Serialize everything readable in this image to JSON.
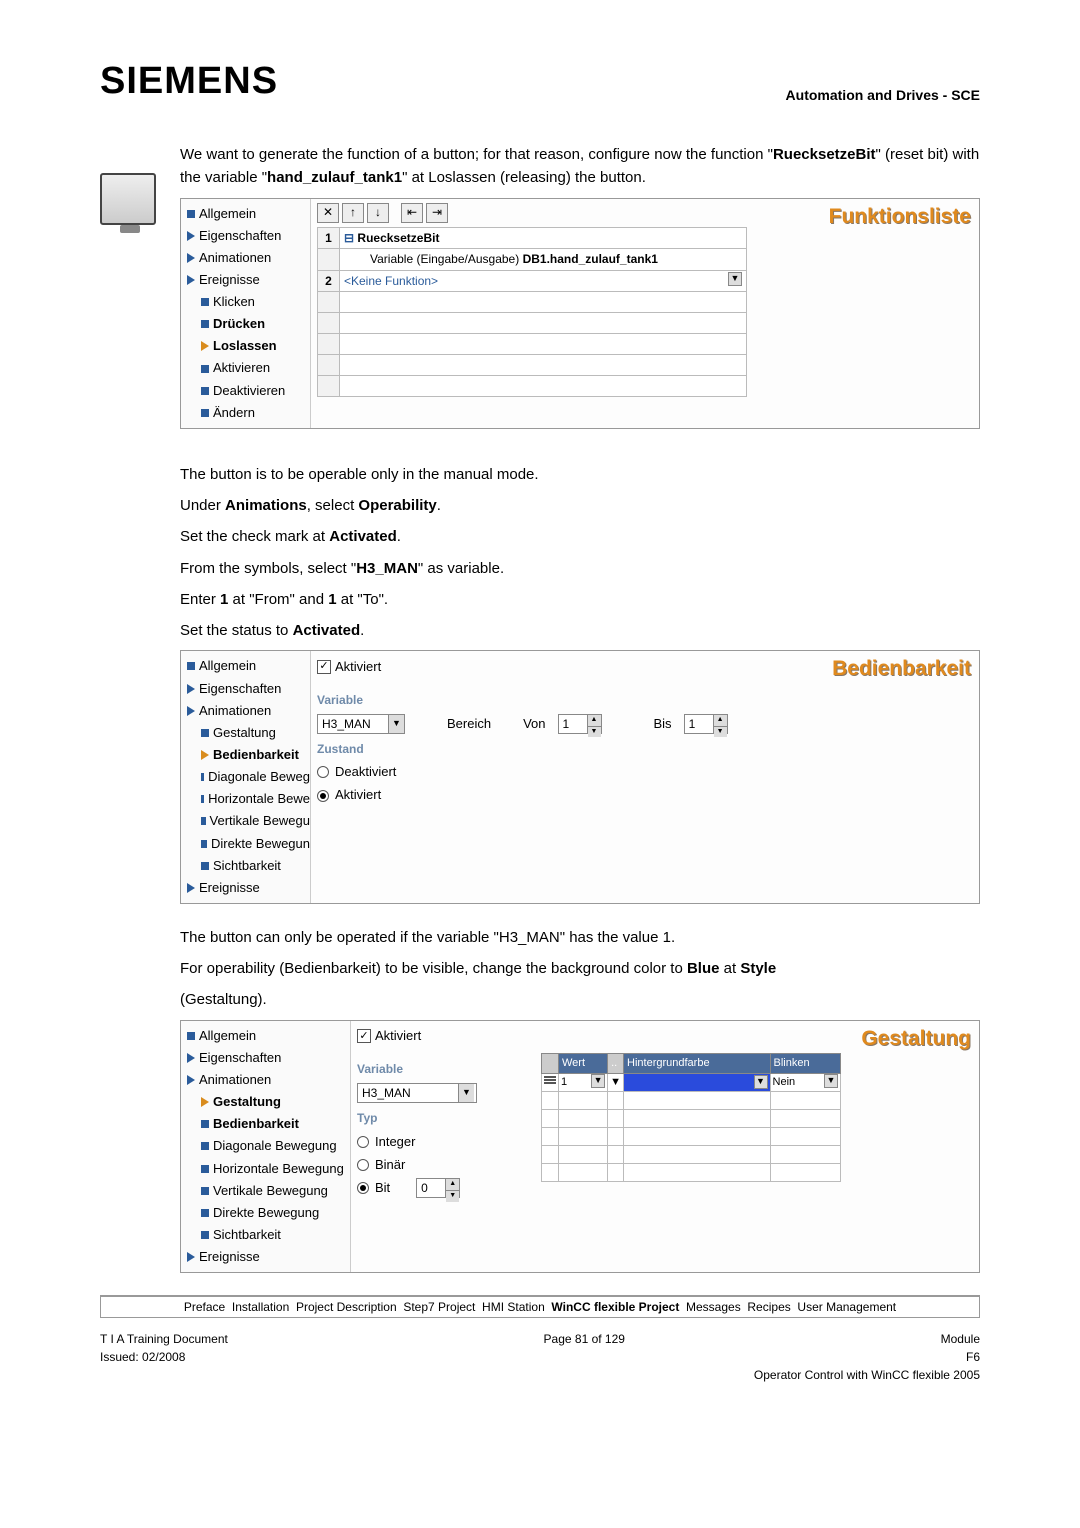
{
  "header": {
    "logo": "SIEMENS",
    "right": "Automation and Drives - SCE"
  },
  "intro": {
    "l1a": "We want to generate the function of a button; for that reason, configure now the ",
    "function": "function",
    "l2a": "\"",
    "fn_name": "RuecksetzeBit",
    "l2b": "\" (reset bit) with the variable \"",
    "var_name": "hand_zulauf_tank1",
    "l2c": "\" at Loslassen (releasing) the button."
  },
  "panel1": {
    "title": "Funktionsliste",
    "tree": {
      "t0": "Allgemein",
      "t1": "Eigenschaften",
      "t2": "Animationen",
      "t3": "Ereignisse",
      "e0": "Klicken",
      "e1": "Drücken",
      "e2": "Loslassen",
      "e3": "Aktivieren",
      "e4": "Deaktivieren",
      "e5": "Ändern"
    },
    "row1_fn": "RuecksetzeBit",
    "row1_var_label": "Variable (Eingabe/Ausgabe)",
    "row1_var_val": "DB1.hand_zulauf_tank1",
    "row2_fn": "<Keine Funktion>",
    "num1": "1",
    "num2": "2"
  },
  "mid": {
    "p1": "The button is to be operable only in the manual mode.",
    "p2a": "Under ",
    "p2b": "Animations",
    "p2c": ", select ",
    "p2d": "Operability",
    "p2e": ".",
    "p3a": "Set the check mark at ",
    "p3b": "Activated",
    "p3c": ".",
    "p4a": "From the symbols, select \"",
    "p4b": "H3_MAN",
    "p4c": "\" as variable.",
    "p5a": "Enter ",
    "p5b": "1",
    "p5c": " at \"From\" and ",
    "p5d": "1",
    "p5e": " at \"To\".",
    "p6a": "Set the status to ",
    "p6b": "Activated",
    "p6c": "."
  },
  "panel2": {
    "title": "Bedienbarkeit",
    "tree": {
      "t0": "Allgemein",
      "t1": "Eigenschaften",
      "t2": "Animationen",
      "a0": "Gestaltung",
      "a1": "Bedienbarkeit",
      "a2": "Diagonale Beweg",
      "a3": "Horizontale Bewe",
      "a4": "Vertikale Bewegu",
      "a5": "Direkte Bewegun",
      "a6": "Sichtbarkeit",
      "t3": "Ereignisse"
    },
    "aktiviert": "Aktiviert",
    "sec_var": "Variable",
    "var_val": "H3_MAN",
    "bereich": "Bereich",
    "von": "Von",
    "von_val": "1",
    "bis": "Bis",
    "bis_val": "1",
    "sec_zustand": "Zustand",
    "r_deakt": "Deaktiviert",
    "r_akt": "Aktiviert"
  },
  "mid2": {
    "p1": "The button can only be operated if the variable \"H3_MAN\" has the value 1.",
    "p2a": "For operability (Bedienbarkeit) to be visible, change the background color to ",
    "p2b": "Blue",
    "p2c": " at ",
    "p2d": "Style",
    "p3": "(Gestaltung)."
  },
  "panel3": {
    "title": "Gestaltung",
    "tree": {
      "t0": "Allgemein",
      "t1": "Eigenschaften",
      "t2": "Animationen",
      "a0": "Gestaltung",
      "a1": "Bedienbarkeit",
      "a2": "Diagonale Bewegung",
      "a3": "Horizontale Bewegung",
      "a4": "Vertikale Bewegung",
      "a5": "Direkte Bewegung",
      "a6": "Sichtbarkeit",
      "t3": "Ereignisse"
    },
    "aktiviert": "Aktiviert",
    "sec_var": "Variable",
    "var_val": "H3_MAN",
    "sec_typ": "Typ",
    "typ_int": "Integer",
    "typ_bin": "Binär",
    "typ_bit": "Bit",
    "bit_val": "0",
    "th_wert": "Wert",
    "th_hgf": "Hintergrundfarbe",
    "th_blinken": "Blinken",
    "cell_wert": "1",
    "cell_blinken": "Nein"
  },
  "breadcrumb": {
    "a": "Preface",
    "b": "Installation",
    "c": "Project Description",
    "d": "Step7 Project",
    "e": "HMI Station",
    "f": "WinCC flexible Project",
    "g": "Messages",
    "h": "Recipes",
    "i": "User Management"
  },
  "footer": {
    "l1": "T I A  Training Document",
    "c1": "Page 81 of 129",
    "r1": "Module",
    "r1b": "F6",
    "l2": "Issued: 02/2008",
    "r2": "Operator Control with WinCC flexible 2005"
  }
}
